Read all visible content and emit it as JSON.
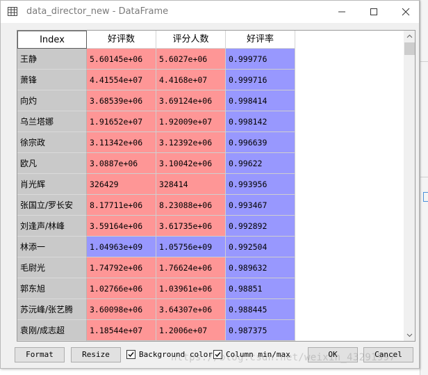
{
  "window": {
    "title": "data_director_new - DataFrame"
  },
  "table": {
    "columns": {
      "index": "Index",
      "col1": "好评数",
      "col2": "评分人数",
      "col3": "好评率"
    },
    "colors": {
      "red": "#fe9696",
      "blue": "#9898fe",
      "index_bg": "#c9c9c9"
    },
    "rows": [
      {
        "index": "王静",
        "v1": "5.60145e+06",
        "v2": "5.6027e+06",
        "v3": "0.999776",
        "c1": "red",
        "c2": "red",
        "c3": "blue"
      },
      {
        "index": "萧锋",
        "v1": "4.41554e+07",
        "v2": "4.4168e+07",
        "v3": "0.999716",
        "c1": "red",
        "c2": "red",
        "c3": "blue"
      },
      {
        "index": "向灼",
        "v1": "3.68539e+06",
        "v2": "3.69124e+06",
        "v3": "0.998414",
        "c1": "red",
        "c2": "red",
        "c3": "blue"
      },
      {
        "index": "乌兰塔娜",
        "v1": "1.91652e+07",
        "v2": "1.92009e+07",
        "v3": "0.998142",
        "c1": "red",
        "c2": "red",
        "c3": "blue"
      },
      {
        "index": "徐宗政",
        "v1": "3.11342e+06",
        "v2": "3.12392e+06",
        "v3": "0.996639",
        "c1": "red",
        "c2": "red",
        "c3": "blue"
      },
      {
        "index": "欧凡",
        "v1": "3.0887e+06",
        "v2": "3.10042e+06",
        "v3": "0.99622",
        "c1": "red",
        "c2": "red",
        "c3": "blue"
      },
      {
        "index": "肖光辉",
        "v1": "326429",
        "v2": "328414",
        "v3": "0.993956",
        "c1": "red",
        "c2": "red",
        "c3": "blue"
      },
      {
        "index": "张国立/罗长安",
        "v1": "8.17711e+06",
        "v2": "8.23088e+06",
        "v3": "0.993467",
        "c1": "red",
        "c2": "red",
        "c3": "blue"
      },
      {
        "index": "刘逢声/林峰",
        "v1": "3.59164e+06",
        "v2": "3.61735e+06",
        "v3": "0.992892",
        "c1": "red",
        "c2": "red",
        "c3": "blue"
      },
      {
        "index": "林添一",
        "v1": "1.04963e+09",
        "v2": "1.05756e+09",
        "v3": "0.992504",
        "c1": "blue",
        "c2": "blue",
        "c3": "blue"
      },
      {
        "index": "毛尉光",
        "v1": "1.74792e+06",
        "v2": "1.76624e+06",
        "v3": "0.989632",
        "c1": "red",
        "c2": "red",
        "c3": "blue"
      },
      {
        "index": "郭东旭",
        "v1": "1.02766e+06",
        "v2": "1.03961e+06",
        "v3": "0.98851",
        "c1": "red",
        "c2": "red",
        "c3": "blue"
      },
      {
        "index": "苏沅峰/张艺腾",
        "v1": "3.60098e+06",
        "v2": "3.64307e+06",
        "v3": "0.988445",
        "c1": "red",
        "c2": "red",
        "c3": "blue"
      },
      {
        "index": "袁刚/成志超",
        "v1": "1.18544e+07",
        "v2": "1.2006e+07",
        "v3": "0.987375",
        "c1": "red",
        "c2": "red",
        "c3": "blue"
      }
    ]
  },
  "bottom": {
    "format_label": "Format",
    "resize_label": "Resize",
    "background_color_label": "Background color",
    "background_color_checked": true,
    "column_minmax_label": "Column min/max",
    "column_minmax_checked": true,
    "ok_label": "OK",
    "cancel_label": "Cancel"
  },
  "watermark": "https://blog.csdn.net/weixin_43291997",
  "icons": {
    "app": "table-icon",
    "minimize": "minimize-icon",
    "maximize": "maximize-icon",
    "close": "close-icon",
    "scroll_up": "arrow-up-icon",
    "scroll_down": "arrow-down-icon",
    "checkbox": "checkmark-icon"
  }
}
